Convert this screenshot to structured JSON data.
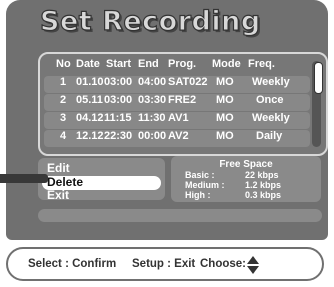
{
  "title": "Set Recording",
  "table": {
    "headers": [
      "No",
      "Date",
      "Start",
      "End",
      "Prog.",
      "Mode",
      "Freq."
    ],
    "rows": [
      {
        "no": "1",
        "date": "01.10",
        "start": "03:00",
        "end": "04:00",
        "prog": "SAT022",
        "mode": "MO",
        "freq": "Weekly"
      },
      {
        "no": "2",
        "date": "05.11",
        "start": "03:00",
        "end": "03:30",
        "prog": "FRE2",
        "mode": "MO",
        "freq": "Once"
      },
      {
        "no": "3",
        "date": "04.12",
        "start": "11:15",
        "end": "11:30",
        "prog": "AV1",
        "mode": "MO",
        "freq": "Weekly"
      },
      {
        "no": "4",
        "date": "12.12",
        "start": "22:30",
        "end": "00:00",
        "prog": "AV2",
        "mode": "MO",
        "freq": "Daily"
      }
    ]
  },
  "menu": {
    "items": [
      "Edit",
      "Delete",
      "Exit"
    ],
    "selected": "Delete"
  },
  "free_space": {
    "title": "Free Space",
    "lines": [
      {
        "label": "Basic :",
        "value": "22 kbps"
      },
      {
        "label": "Medium :",
        "value": "1.2 kbps"
      },
      {
        "label": "High :",
        "value": "0.3 kbps"
      }
    ]
  },
  "footer": {
    "select": "Select : Confirm",
    "setup": "Setup : Exit",
    "choose": "Choose:"
  },
  "icons": {
    "choose": "up-down-arrow-icon"
  },
  "colors": {
    "screen_bg": "#707070",
    "panel_bg": "#8a8a8a",
    "highlight": "#ffffff"
  }
}
